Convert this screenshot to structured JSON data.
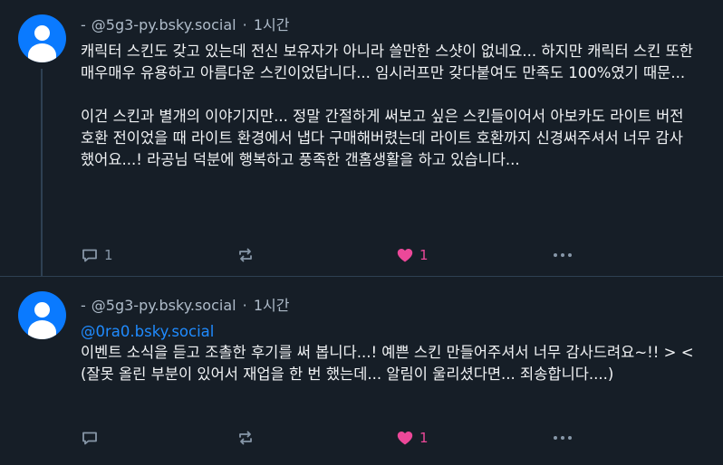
{
  "posts": [
    {
      "handle": "@5g3-py.bsky.social",
      "time": "1시간",
      "paragraphs": [
        "캐릭터 스킨도 갖고 있는데 전신 보유자가 아니라 쓸만한 스샷이 없네요... 하지만 캐릭터 스킨 또한 매우매우 유용하고 아름다운 스킨이었답니다... 임시러프만 갖다붙여도 만족도 100%였기 때문...",
        "이건 스킨과 별개의 이야기지만... 정말 간절하게 써보고 싶은 스킨들이어서 아보카도 라이트 버전 호환 전이었을 때 라이트 환경에서 냅다 구매해버렸는데 라이트 호환까지 신경써주셔서 너무 감사했어요...! 라공님 덕분에 행복하고 풍족한 갠홈생활을 하고 있습니다..."
      ],
      "reply_count": "1",
      "repost_count": "",
      "like_count": "1",
      "like_color": "#ec4899"
    },
    {
      "handle": "@5g3-py.bsky.social",
      "time": "1시간",
      "mention": "@0ra0.bsky.social",
      "body": "이벤트 소식을 듣고 조촐한 후기를 써 봅니다...! 예쁜 스킨 만들어주셔서 너무 감사드려요~!! > < (잘못 올린 부분이 있어서 재업을 한 번 했는데... 알림이 울리셨다면... 죄송합니다....)",
      "reply_count": "",
      "repost_count": "",
      "like_count": "1",
      "like_color": "#ec4899"
    }
  ],
  "icons": {
    "avatar": "default-user-avatar",
    "reply": "speech-bubble-icon",
    "repost": "repost-arrows-icon",
    "like": "heart-icon",
    "more": "ellipsis-icon"
  },
  "colors": {
    "background": "#161e27",
    "handle": "#aebbc9",
    "mention": "#208bfe",
    "avatar": "#0a7aff"
  }
}
